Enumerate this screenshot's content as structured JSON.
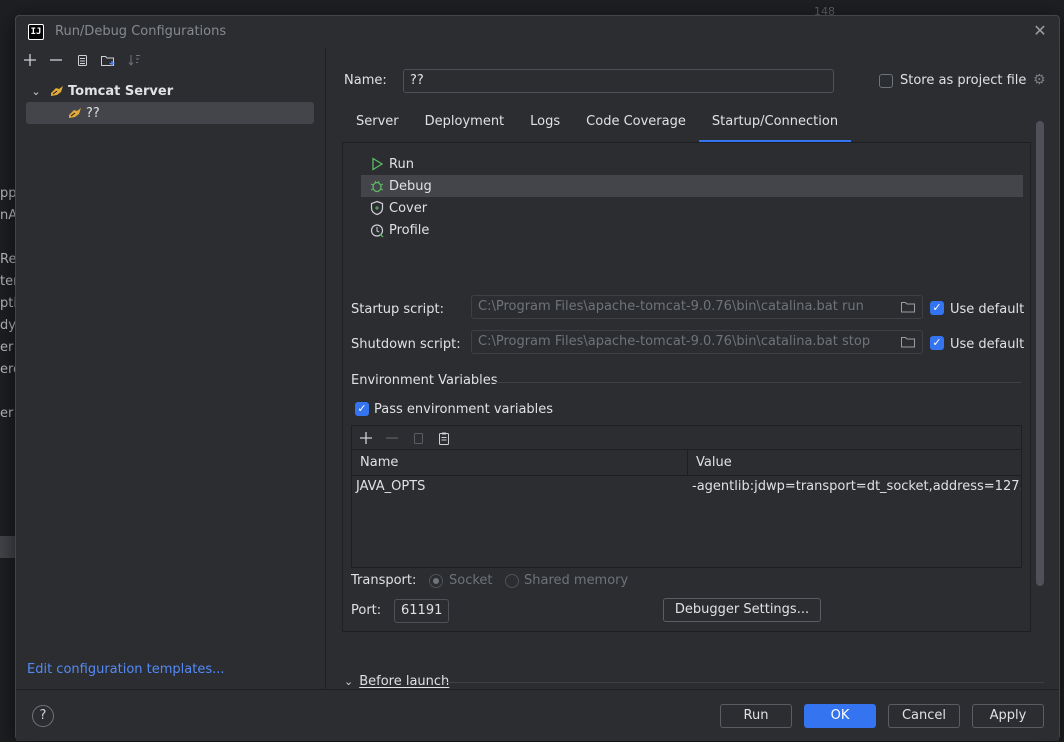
{
  "background": {
    "line_number": "148",
    "fragments": [
      "pp",
      "nA",
      "Re",
      "ter",
      "pti",
      "dy",
      "er",
      "erc",
      "er"
    ]
  },
  "dialog": {
    "title": "Run/Debug Configurations",
    "app_icon_label": "IJ"
  },
  "tree": {
    "group_label": "Tomcat Server",
    "item_label": "??"
  },
  "edit_templates_link": "Edit configuration templates...",
  "name_label": "Name:",
  "name_value": "??",
  "store_as_project_file": "Store as project file",
  "tabs": [
    "Server",
    "Deployment",
    "Logs",
    "Code Coverage",
    "Startup/Connection"
  ],
  "active_tab": "Startup/Connection",
  "launch_modes": [
    "Run",
    "Debug",
    "Cover",
    "Profile"
  ],
  "selected_mode": "Debug",
  "startup_script": {
    "label": "Startup script:",
    "value": "C:\\Program Files\\apache-tomcat-9.0.76\\bin\\catalina.bat run",
    "use_default": "Use default"
  },
  "shutdown_script": {
    "label": "Shutdown script:",
    "value": "C:\\Program Files\\apache-tomcat-9.0.76\\bin\\catalina.bat stop",
    "use_default": "Use default"
  },
  "env": {
    "section_title": "Environment Variables",
    "pass_env": "Pass environment variables",
    "columns": [
      "Name",
      "Value"
    ],
    "rows": [
      {
        "name": "JAVA_OPTS",
        "value": "-agentlib:jdwp=transport=dt_socket,address=127...."
      }
    ]
  },
  "transport": {
    "label": "Transport:",
    "options": [
      "Socket",
      "Shared memory"
    ],
    "selected": "Socket"
  },
  "port": {
    "label": "Port:",
    "value": "61191"
  },
  "debugger_settings_button": "Debugger Settings...",
  "before_launch": "Before launch",
  "buttons": {
    "run": "Run",
    "ok": "OK",
    "cancel": "Cancel",
    "apply": "Apply",
    "help": "?"
  },
  "colors": {
    "accent": "#3574f0",
    "link": "#548af7",
    "dialog_bg": "#2b2d30"
  }
}
